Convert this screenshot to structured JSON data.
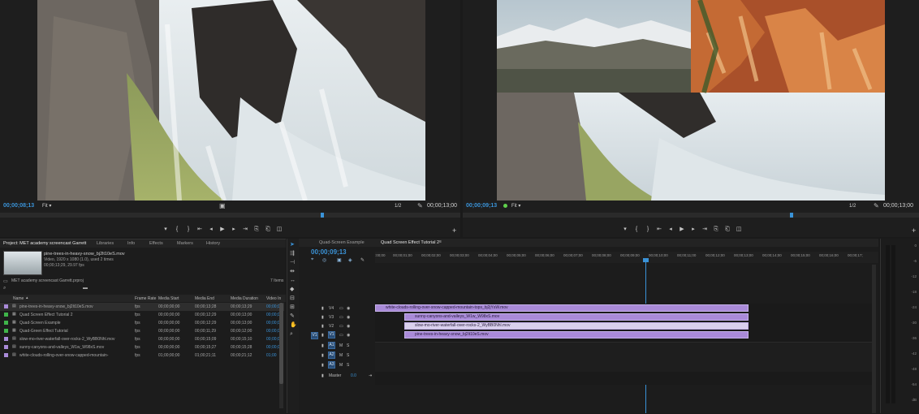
{
  "source_monitor": {
    "timecode_in": "00;00;08;13",
    "fit_label": "Fit",
    "scale": "1/2",
    "timecode_out": "00;00;13;00",
    "controls": [
      "▾",
      "{",
      "}",
      "⇤",
      "◂",
      "▶",
      "▸",
      "⇥",
      "⎘",
      "⎗",
      "◫"
    ]
  },
  "program_monitor": {
    "timecode_in": "00;00;09;13",
    "fit_label": "Fit",
    "scale": "1/2",
    "timecode_out": "00;00;13;00",
    "controls": [
      "▾",
      "{",
      "}",
      "⇤",
      "◂",
      "▶",
      "▸",
      "⇥",
      "⎘",
      "⎗",
      "◫"
    ]
  },
  "project_panel": {
    "tabs": [
      "Project: MET academy screencast Garrett",
      "Libraries",
      "Info",
      "Effects",
      "Markers",
      "History"
    ],
    "preview": {
      "name": "pine-trees-in-heavy-snow_bj2lt10eS.mov",
      "info1": "Video, 1920 x 1080 (1.0)",
      "info2": "00;00;13;29, 29.97 fps",
      "used": ", used 2 times"
    },
    "project_file": "MET academy screencast Garrett.prproj",
    "item_count": "7 Items",
    "columns": [
      "Name",
      "Frame Rate",
      "Media Start",
      "Media End",
      "Media Duration",
      "Video In"
    ],
    "rows": [
      {
        "name": "pine-trees-in-heavy-snow_bj2lt10eS.mov",
        "rate": "fps",
        "start": "00;00;00;00",
        "end": "00;00;13;28",
        "dur": "00;00;13;29",
        "vin": "00;00;00",
        "color": "#a98ad8"
      },
      {
        "name": "Quad Screen Effect Tutorial 2",
        "rate": "fps",
        "start": "00;00;00;00",
        "end": "00;00;12;29",
        "dur": "00;00;13;00",
        "vin": "00;00;00",
        "color": "#3fb44a"
      },
      {
        "name": "Quad-Screen Example",
        "rate": "fps",
        "start": "00;00;00;00",
        "end": "00;00;12;29",
        "dur": "00;00;13;00",
        "vin": "00;00;00",
        "color": "#3fb44a"
      },
      {
        "name": "Quad-Green Effect Tutorial",
        "rate": "fps",
        "start": "00;00;00;00",
        "end": "00;00;11;29",
        "dur": "00;00;12;00",
        "vin": "00;00;00",
        "color": "#3fb44a"
      },
      {
        "name": "slow-mo-river-waterfall-over-rocks-2_WyBB0Nhl.mov",
        "rate": "fps",
        "start": "00;00;00;00",
        "end": "00;00;15;09",
        "dur": "00;00;15;10",
        "vin": "00;00;00",
        "color": "#a98ad8"
      },
      {
        "name": "sunny-canyons-and-valleys_W1w_W98xS.mov",
        "rate": "fps",
        "start": "00;00;00;00",
        "end": "00;00;15;27",
        "dur": "00;00;15;28",
        "vin": "00;00;00",
        "color": "#a98ad8"
      },
      {
        "name": "white-clouds-rolling-over-snow-capped-mountain-",
        "rate": "fps",
        "start": "01;00;00;00",
        "end": "01;00;21;11",
        "dur": "00;00;21;12",
        "vin": "01;00",
        "color": "#a98ad8"
      }
    ]
  },
  "timeline": {
    "tabs": [
      "Quad-Screen Example",
      "Quad Screen Effect Tutorial 2"
    ],
    "timecode": "00;00;09;13",
    "ruler": [
      ":00;00",
      "00;00;01;00",
      "00;00;02;00",
      "00;00;03;00",
      "00;00;04;00",
      "00;00;05;00",
      "00;00;06;00",
      "00;00;07;00",
      "00;00;08;00",
      "00;00;09;00",
      "00;00;10;00",
      "00;00;11;00",
      "00;00;12;00",
      "00;00;13;00",
      "00;00;14;00",
      "00;00;15;00",
      "00;00;16;00",
      "00;00;17;"
    ],
    "video_tracks": [
      "V4",
      "V3",
      "V2",
      "V1"
    ],
    "audio_tracks": [
      "A1",
      "A2",
      "A3"
    ],
    "master_label": "Master",
    "master_value": "0.0",
    "clips": [
      {
        "name": "white-clouds-rolling-over-snow-capped-mountain-tops_bj2jYsW.mov",
        "track": "V4"
      },
      {
        "name": "sunny-canyons-and-valleys_W1w_W98xS.mov",
        "track": "V3"
      },
      {
        "name": "slow-mo-river-waterfall-over-rocks-2_WyBB0Nhl.mov",
        "track": "V2"
      },
      {
        "name": "pine-trees-in-heavy-snow_bj2lt10eS.mov",
        "track": "V1"
      }
    ],
    "source_patch_v": "V1",
    "source_patch_a": "A1"
  },
  "audio_meter": {
    "scale": [
      "0",
      "-6",
      "-12",
      "-18",
      "-24",
      "-30",
      "-36",
      "-42",
      "-48",
      "-54",
      "dB"
    ]
  }
}
